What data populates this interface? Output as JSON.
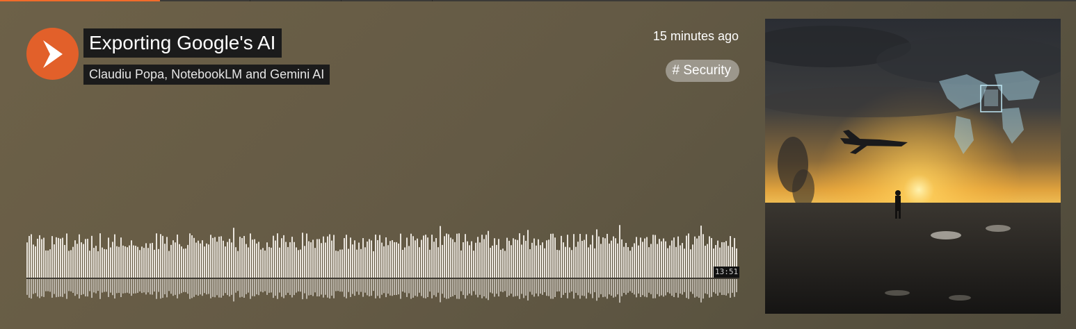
{
  "episode": {
    "title": "Exporting Google's AI",
    "authors": "Claudiu Popa, NotebookLM and Gemini AI",
    "published": "15 minutes ago",
    "tag": "# Security",
    "duration": "13:51",
    "progress": 0.15
  },
  "player": {
    "play_icon": "play-chevron-icon",
    "accent_color": "#e2602a"
  },
  "artwork": {
    "icon": "drone-battlefield-artwork"
  }
}
